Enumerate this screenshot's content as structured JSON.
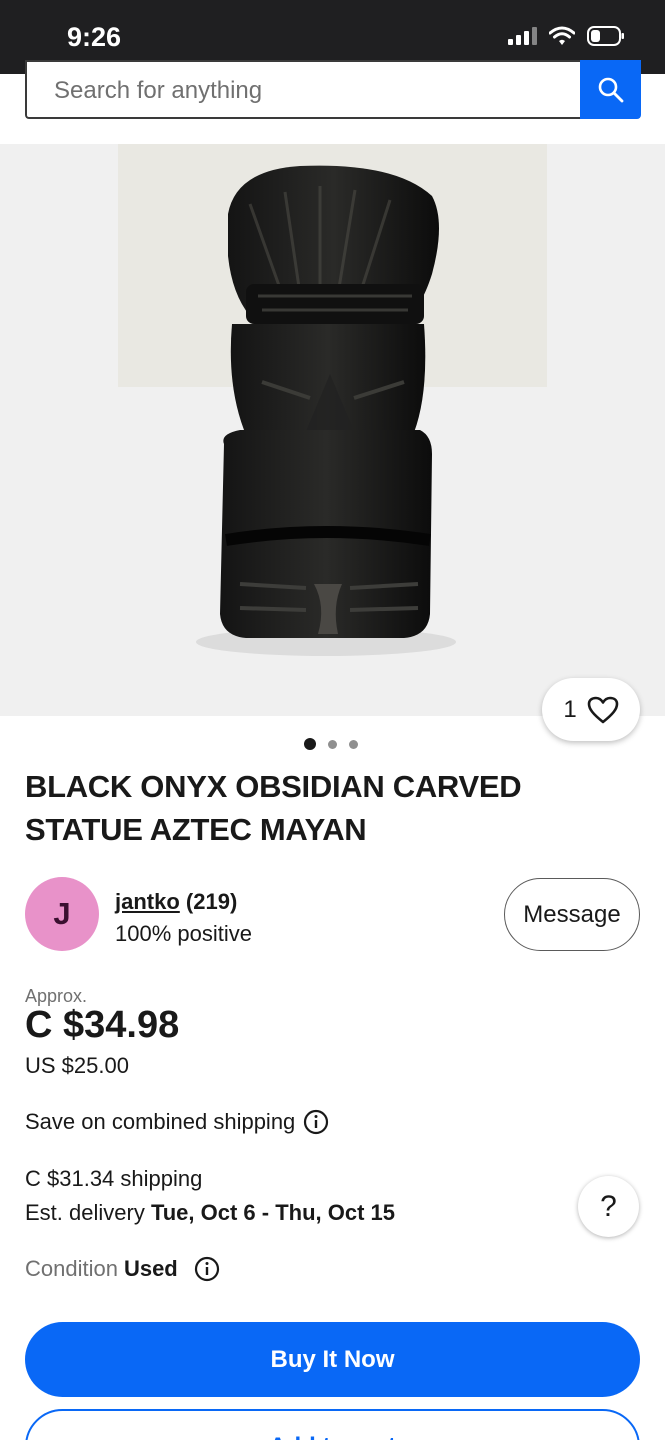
{
  "status_bar": {
    "time": "9:26",
    "icons": [
      "signal-icon",
      "wifi-icon",
      "battery-icon"
    ]
  },
  "search": {
    "placeholder": "Search for anything",
    "button_icon": "search-icon"
  },
  "gallery": {
    "image_alt": "",
    "like_count": "1",
    "like_icon": "heart-icon",
    "dots": 3,
    "active_dot": 0
  },
  "listing": {
    "title": "BLACK ONYX OBSIDIAN CARVED STATUE AZTEC MAYAN"
  },
  "seller": {
    "avatar_letter": "J",
    "name": "jantko",
    "count": "(219)",
    "feedback": "100% positive",
    "message_label": "Message"
  },
  "price": {
    "approx_label": "Approx.",
    "main": "C $34.98",
    "usd": "US $25.00"
  },
  "shipping": {
    "combined": "Save on combined shipping",
    "cost": "C $31.34 shipping",
    "delivery_prefix": "Est. delivery ",
    "delivery_dates": "Tue, Oct 6 - Thu, Oct 15",
    "help_label": "?"
  },
  "condition": {
    "label": "Condition",
    "value": "Used"
  },
  "actions": {
    "buy_now": "Buy It Now",
    "add_to_cart": "Add to cart"
  },
  "colors": {
    "accent": "#0968f6",
    "status_bar": "#1f1f21",
    "avatar": "#e892c9"
  }
}
